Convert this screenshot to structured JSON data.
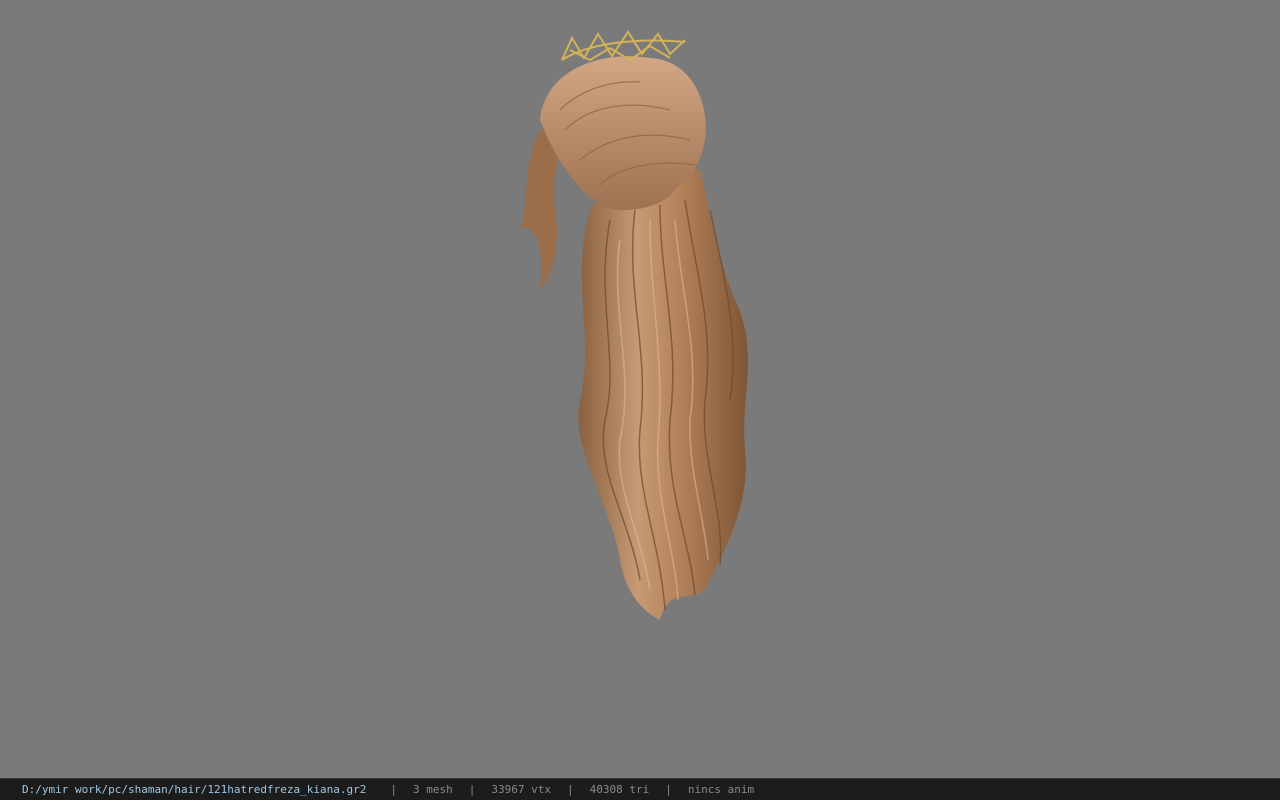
{
  "viewport": {
    "background_color": "#7a7a7a",
    "model_icon": "hair-model-icon",
    "hair_color": "#b98a63",
    "accent_color": "#d4b25a"
  },
  "statusbar": {
    "file_path": "D:/ymir work/pc/shaman/hair/121hatredfreza_kiana.gr2",
    "separator": "|",
    "mesh": "3 mesh",
    "vtx": "33967 vtx",
    "tri": "40308 tri",
    "anim": "nincs anim",
    "path_color": "#9fc6e0",
    "text_color": "#8a8a8a"
  }
}
